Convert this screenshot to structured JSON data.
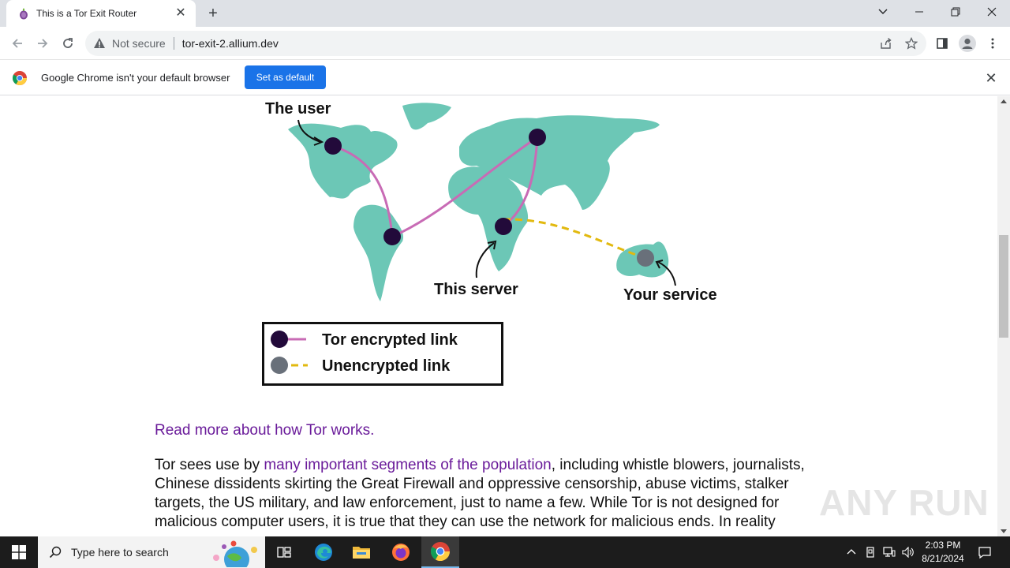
{
  "browser": {
    "tab_title": "This is a Tor Exit Router",
    "tab_close": "✕",
    "new_tab": "+",
    "omnibox": {
      "security_label": "Not secure",
      "url": "tor-exit-2.allium.dev"
    },
    "window_controls": {
      "tab_search": "⌄",
      "minimize": "—",
      "restore": "❐",
      "close": "✕"
    }
  },
  "infobar": {
    "message": "Google Chrome isn't your default browser",
    "button": "Set as default",
    "close": "✕"
  },
  "page": {
    "map": {
      "labels": {
        "user": "The user",
        "server": "This server",
        "service": "Your service"
      },
      "colors": {
        "land": "#6cc7b6",
        "node": "#220a3a",
        "tor_link": "#c86bb5",
        "unencrypted_link": "#e2b90f",
        "service_node": "#69707a"
      },
      "legend": {
        "tor": "Tor encrypted link",
        "unencrypted": "Unencrypted link"
      }
    },
    "read_more": "Read more about how Tor works.",
    "paragraph": {
      "lead": "Tor sees use by ",
      "link": "many important segments of the population",
      "rest": ", including whistle blowers, journalists, Chinese dissidents skirting the Great Firewall and oppressive censorship, abuse victims, stalker targets, the US military, and law enforcement, just to name a few. While Tor is not designed for malicious computer users, it is true that they can use the network for malicious ends. In reality"
    },
    "watermark": "ANY RUN"
  },
  "taskbar": {
    "search_placeholder": "Type here to search",
    "clock_time": "2:03 PM",
    "clock_date": "8/21/2024",
    "apps": [
      "task-view",
      "edge",
      "file-explorer",
      "firefox",
      "chrome"
    ]
  }
}
